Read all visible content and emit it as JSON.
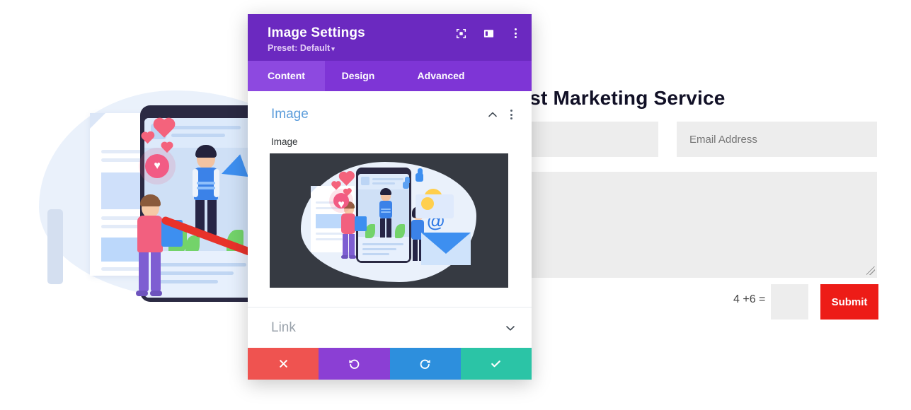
{
  "background_page": {
    "heading": "Best Marketing Service",
    "form": {
      "name_field": {
        "value": "",
        "placeholder": ""
      },
      "email_field": {
        "value": "",
        "placeholder": "Email Address"
      },
      "message_field": {
        "value": "",
        "placeholder": ""
      },
      "captcha_label": "4 +6 =",
      "captcha_input": {
        "value": "",
        "placeholder": ""
      },
      "submit_label": "Submit",
      "submit_color": "#ed1c17"
    },
    "illustration_alt": "marketing-illustration"
  },
  "annotation": {
    "arrow_color": "#e8322a",
    "arrow_name": "red-annotation-arrow"
  },
  "modal": {
    "title": "Image Settings",
    "preset_label": "Preset: Default",
    "preset_caret": "▾",
    "header_color": "#6b29c0",
    "header_icons": [
      {
        "name": "focus-target-icon"
      },
      {
        "name": "layout-panel-icon"
      },
      {
        "name": "kebab-menu-icon"
      }
    ],
    "tabs": [
      {
        "label": "Content",
        "active": true
      },
      {
        "label": "Design",
        "active": false
      },
      {
        "label": "Advanced",
        "active": false
      }
    ],
    "section": {
      "title": "Image",
      "title_color": "#5c9ddb",
      "field_label": "Image",
      "collapse_icon": "chevron-up-icon",
      "options_icon": "kebab-menu-icon",
      "preview_bg": "#363a42"
    },
    "link_section": {
      "title": "Link",
      "expand_icon": "chevron-down-icon"
    },
    "actions": [
      {
        "name": "cancel-button",
        "glyph": "✕",
        "color": "#ef5350"
      },
      {
        "name": "undo-button",
        "glyph": "↺",
        "color": "#8b3fd4"
      },
      {
        "name": "redo-button",
        "glyph": "↻",
        "color": "#2d8fdd"
      },
      {
        "name": "save-button",
        "glyph": "✔",
        "color": "#2bc4a6"
      }
    ]
  }
}
